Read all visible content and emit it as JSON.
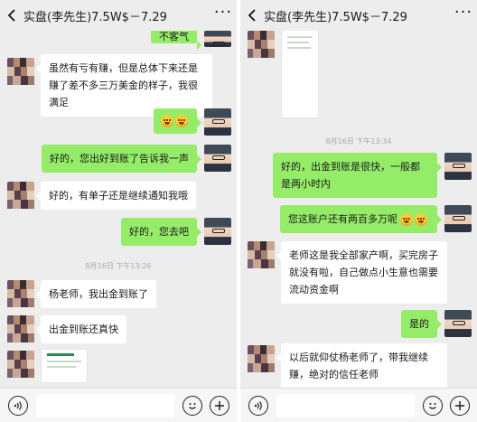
{
  "left": {
    "header": {
      "title": "实盘(李先生)7.5W$－7.29",
      "more": "···"
    },
    "messages": {
      "m1": "不客气",
      "m2": "虽然有亏有赚，但是总体下来还是赚了差不多三万美金的样子，我很满足",
      "m4": "好的，您出好到账了告诉我一声",
      "m5": "好的，有单子还是继续通知我哦",
      "m6": "好的，您去吧",
      "time1": "8月16日 下午13:26",
      "m7": "杨老师，我出金到账了",
      "m8": "出金到账还真快"
    }
  },
  "right": {
    "header": {
      "title": "实盘(李先生)7.5W$－7.29",
      "more": "···"
    },
    "messages": {
      "time1": "8月16日 下午13:34",
      "m1": "好的，出金到账是很快，一般都是两小时内",
      "m2": "您这账户还有两百多万呢",
      "m3": "老师这是我全部家产啊，买完房子就没有啦，自己做点小生意也需要流动资金啊",
      "m4": "是的",
      "m5": "以后就仰仗杨老师了，带我继续赚，绝对的信任老师"
    }
  },
  "icons": {
    "back": "chevron-left-icon",
    "voice": "voice-icon",
    "emoji": "smile-icon",
    "plus": "plus-icon"
  },
  "colors": {
    "bubble_me": "#95ec69",
    "bubble_other": "#ffffff",
    "background": "#ededed"
  }
}
